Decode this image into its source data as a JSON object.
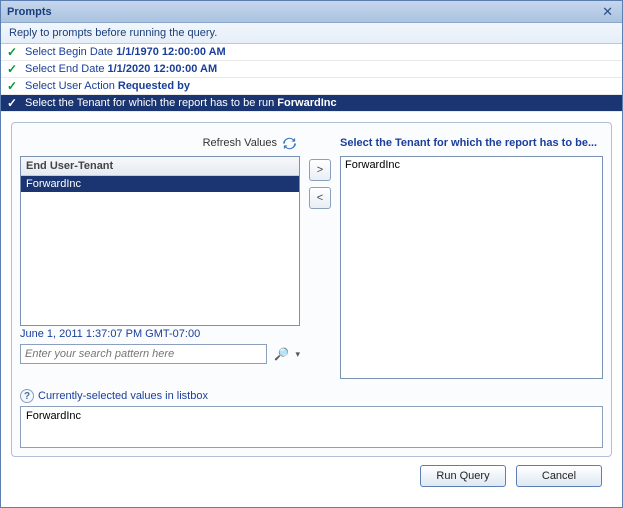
{
  "dialog": {
    "title": "Prompts",
    "subtitle": "Reply to prompts before running the query."
  },
  "prompts": [
    {
      "label": "Select Begin Date",
      "value": "1/1/1970 12:00:00 AM",
      "selected": false
    },
    {
      "label": "Select End Date",
      "value": "1/1/2020 12:00:00 AM",
      "selected": false
    },
    {
      "label": "Select User Action",
      "value": "Requested by",
      "selected": false
    },
    {
      "label": "Select the Tenant for which the report has to be run",
      "value": "ForwardInc",
      "selected": true
    }
  ],
  "leftPanel": {
    "refreshLabel": "Refresh Values",
    "listHeader": "End User-Tenant",
    "items": [
      {
        "label": "ForwardInc",
        "selected": true
      }
    ],
    "timestamp": "June 1, 2011 1:37:07 PM GMT-07:00",
    "searchPlaceholder": "Enter your search pattern here"
  },
  "rightPanel": {
    "title": "Select the Tenant for which the report has to be...",
    "items": [
      "ForwardInc"
    ]
  },
  "selected": {
    "header": "Currently-selected values in listbox",
    "value": "ForwardInc"
  },
  "buttons": {
    "run": "Run Query",
    "cancel": "Cancel"
  }
}
